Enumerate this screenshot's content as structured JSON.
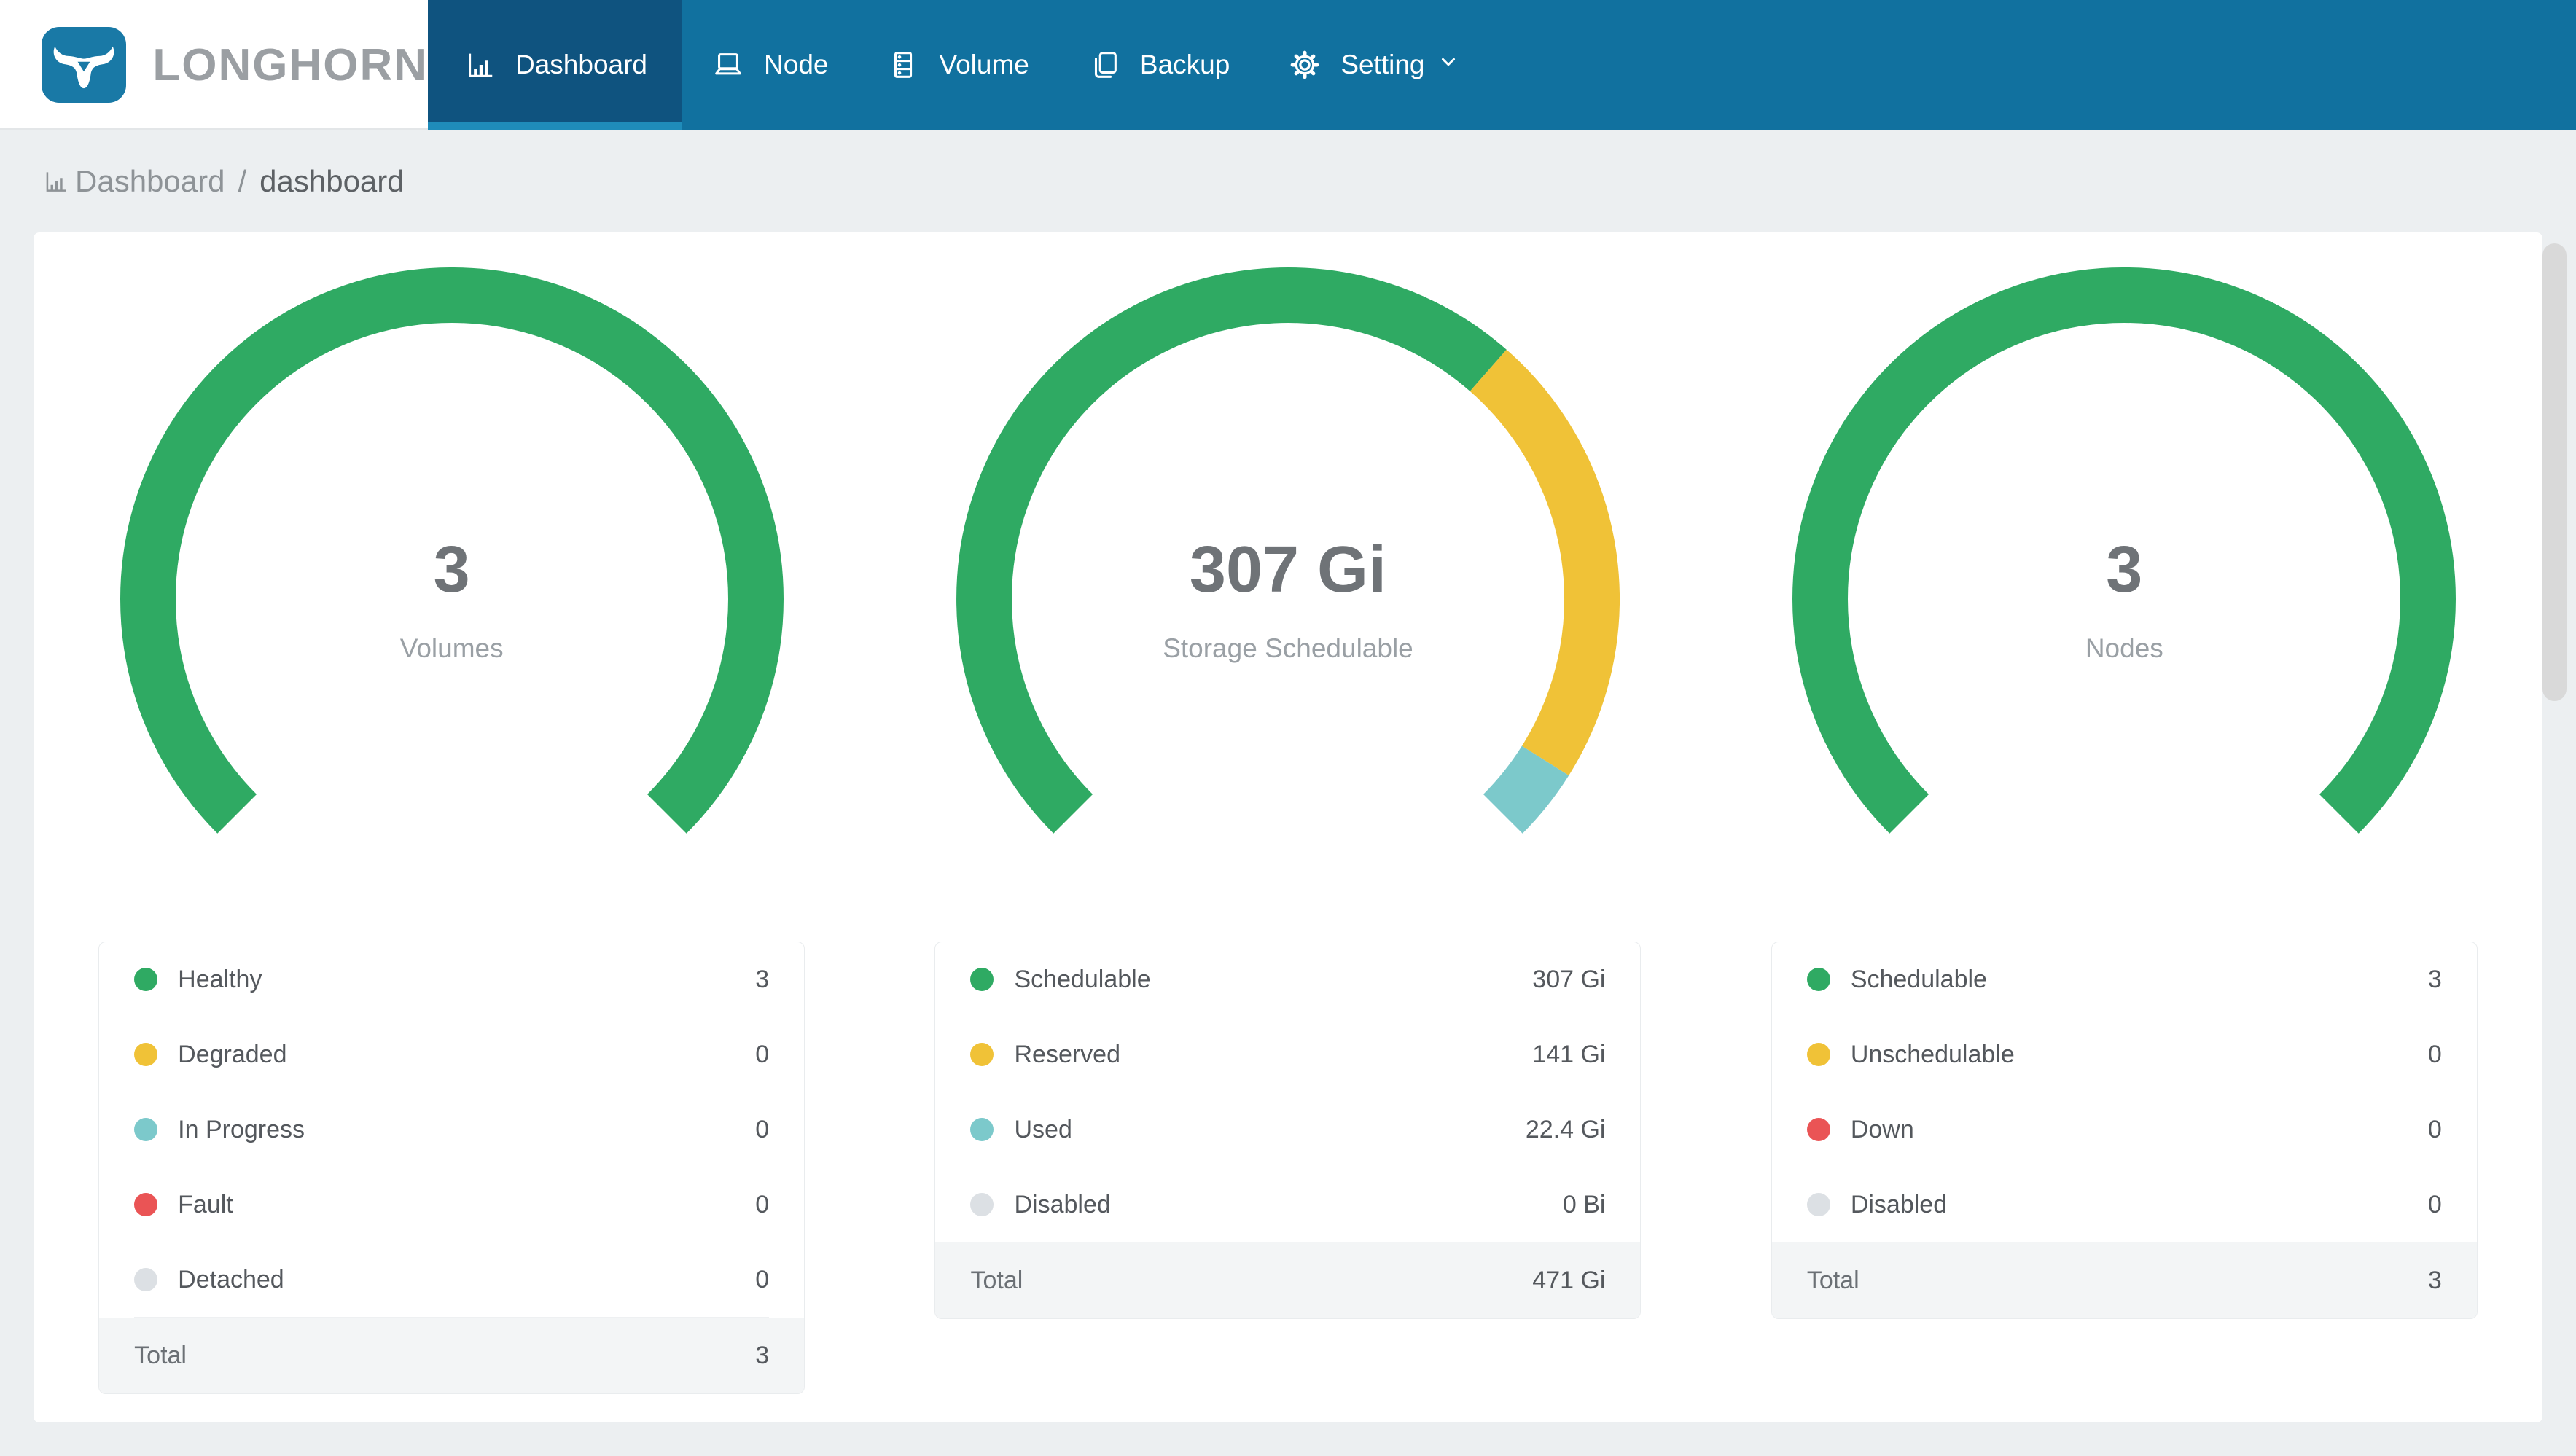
{
  "nav": {
    "brand": "LONGHORN",
    "items": [
      {
        "label": "Dashboard",
        "icon": "bar-chart-icon",
        "active": true
      },
      {
        "label": "Node",
        "icon": "laptop-icon",
        "active": false
      },
      {
        "label": "Volume",
        "icon": "server-rack-icon",
        "active": false
      },
      {
        "label": "Backup",
        "icon": "copy-icon",
        "active": false
      },
      {
        "label": "Setting",
        "icon": "gear-icon",
        "active": false,
        "has_dropdown": true
      }
    ]
  },
  "breadcrumb": {
    "icon": "bar-chart-icon",
    "section": "Dashboard",
    "separator": "/",
    "page": "dashboard"
  },
  "colors": {
    "green": "#2faa63",
    "yellow": "#f0c237",
    "teal": "#7cc9cb",
    "red": "#ea5455",
    "gray": "#dce0e4",
    "nav_blue": "#11719f",
    "nav_active": "#0f537f",
    "nav_underline": "#1f8cba"
  },
  "panels": [
    {
      "center_value": "3",
      "center_label": "Volumes",
      "rows": [
        {
          "label": "Healthy",
          "value": "3",
          "num": 3,
          "color_key": "green"
        },
        {
          "label": "Degraded",
          "value": "0",
          "num": 0,
          "color_key": "yellow"
        },
        {
          "label": "In Progress",
          "value": "0",
          "num": 0,
          "color_key": "teal"
        },
        {
          "label": "Fault",
          "value": "0",
          "num": 0,
          "color_key": "red"
        },
        {
          "label": "Detached",
          "value": "0",
          "num": 0,
          "color_key": "gray"
        }
      ],
      "total_label": "Total",
      "total_value": "3"
    },
    {
      "center_value": "307 Gi",
      "center_label": "Storage Schedulable",
      "rows": [
        {
          "label": "Schedulable",
          "value": "307 Gi",
          "num": 307,
          "color_key": "green"
        },
        {
          "label": "Reserved",
          "value": "141 Gi",
          "num": 141,
          "color_key": "yellow"
        },
        {
          "label": "Used",
          "value": "22.4 Gi",
          "num": 22.4,
          "color_key": "teal"
        },
        {
          "label": "Disabled",
          "value": "0 Bi",
          "num": 0,
          "color_key": "gray"
        }
      ],
      "total_label": "Total",
      "total_value": "471 Gi"
    },
    {
      "center_value": "3",
      "center_label": "Nodes",
      "rows": [
        {
          "label": "Schedulable",
          "value": "3",
          "num": 3,
          "color_key": "green"
        },
        {
          "label": "Unschedulable",
          "value": "0",
          "num": 0,
          "color_key": "yellow"
        },
        {
          "label": "Down",
          "value": "0",
          "num": 0,
          "color_key": "red"
        },
        {
          "label": "Disabled",
          "value": "0",
          "num": 0,
          "color_key": "gray"
        }
      ],
      "total_label": "Total",
      "total_value": "3"
    }
  ],
  "chart_data": [
    {
      "type": "gauge-donut",
      "title": "Volumes",
      "center_text": "3",
      "arc_start_deg": 135,
      "arc_sweep_deg": 270,
      "segments": [
        {
          "name": "Healthy",
          "value": 3,
          "color": "#2faa63"
        },
        {
          "name": "Degraded",
          "value": 0,
          "color": "#f0c237"
        },
        {
          "name": "In Progress",
          "value": 0,
          "color": "#7cc9cb"
        },
        {
          "name": "Fault",
          "value": 0,
          "color": "#ea5455"
        },
        {
          "name": "Detached",
          "value": 0,
          "color": "#dce0e4"
        }
      ],
      "total": 3
    },
    {
      "type": "gauge-donut",
      "title": "Storage Schedulable",
      "center_text": "307 Gi",
      "arc_start_deg": 135,
      "arc_sweep_deg": 270,
      "segments": [
        {
          "name": "Schedulable",
          "value": 307,
          "color": "#2faa63"
        },
        {
          "name": "Reserved",
          "value": 141,
          "color": "#f0c237"
        },
        {
          "name": "Used",
          "value": 22.4,
          "color": "#7cc9cb"
        },
        {
          "name": "Disabled",
          "value": 0,
          "color": "#dce0e4"
        }
      ],
      "total": 470.4,
      "total_display": "471 Gi"
    },
    {
      "type": "gauge-donut",
      "title": "Nodes",
      "center_text": "3",
      "arc_start_deg": 135,
      "arc_sweep_deg": 270,
      "segments": [
        {
          "name": "Schedulable",
          "value": 3,
          "color": "#2faa63"
        },
        {
          "name": "Unschedulable",
          "value": 0,
          "color": "#f0c237"
        },
        {
          "name": "Down",
          "value": 0,
          "color": "#ea5455"
        },
        {
          "name": "Disabled",
          "value": 0,
          "color": "#dce0e4"
        }
      ],
      "total": 3
    }
  ]
}
